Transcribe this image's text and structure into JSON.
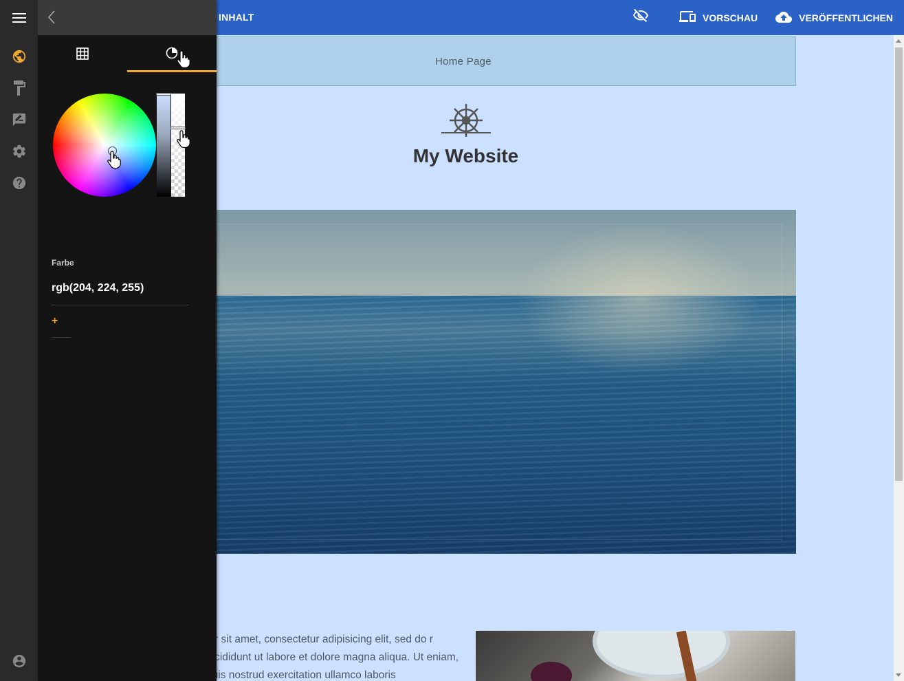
{
  "topbar": {
    "section_label": "INHALT",
    "preview_label": "VORSCHAU",
    "publish_label": "VERÖFFENTLICHEN"
  },
  "site": {
    "menu_item": "Home Page",
    "title": "My Website",
    "body_text": "lor sit amet, consectetur adipisicing elit, sed do r incididunt ut labore et dolore magna aliqua. Ut eniam, quis nostrud exercitation ullamco laboris"
  },
  "panel": {
    "tabs": [
      {
        "icon": "grid-icon"
      },
      {
        "icon": "color-wheel-icon",
        "active": true
      }
    ],
    "color_label": "Farbe",
    "color_value": "rgb(204, 224, 255)",
    "add_label": "+"
  },
  "rail": {
    "icons": [
      "globe-icon",
      "paint-roller-icon",
      "form-icon",
      "gear-icon",
      "help-icon",
      "account-icon"
    ]
  },
  "colors": {
    "topbar": "#2b62c7",
    "page_background": "#cce0ff",
    "accent": "#f0a92c",
    "panel": "#141414",
    "rail": "#2a2a2a"
  }
}
